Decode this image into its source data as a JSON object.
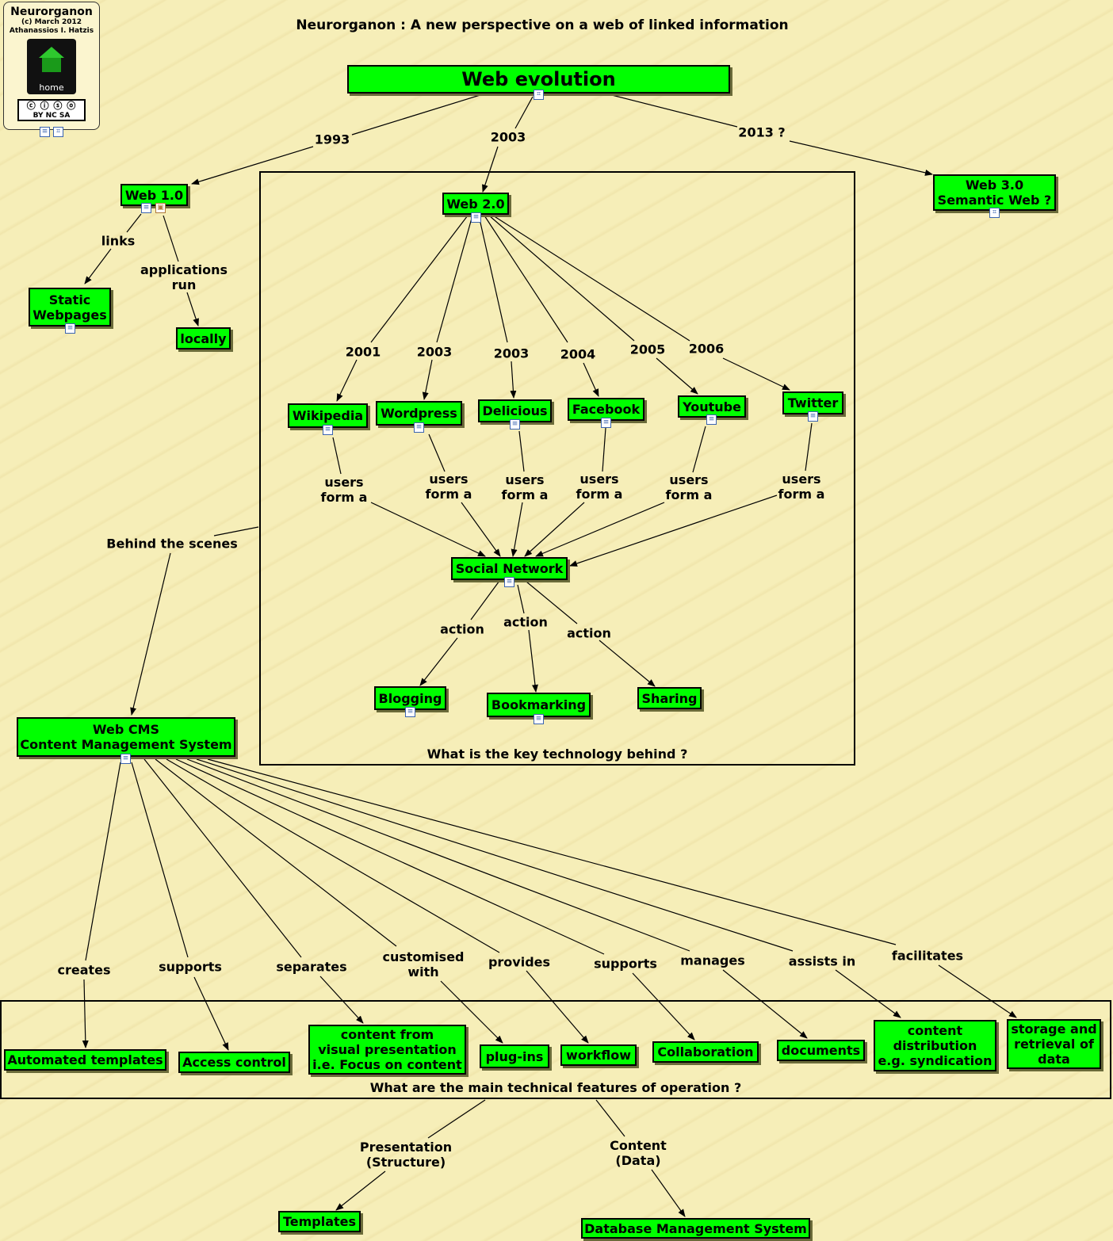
{
  "title": "Neurorganon : A new perspective on a web of linked information",
  "logo": {
    "name": "Neurorganon",
    "copyright": "(c) March 2012",
    "author": "Athanassios I. Hatzis",
    "home_label": "home",
    "license": "BY NC SA"
  },
  "colors": {
    "node_fill": "#00ff00",
    "background": "#f6eeb8",
    "link": "#000000"
  },
  "nodes": {
    "web_evolution": "Web evolution",
    "web10": "Web 1.0",
    "web20": "Web 2.0",
    "web30": "Web 3.0\nSemantic Web ?",
    "static": "Static\nWebpages",
    "locally": "locally",
    "wikipedia": "Wikipedia",
    "wordpress": "Wordpress",
    "delicious": "Delicious",
    "facebook": "Facebook",
    "youtube": "Youtube",
    "twitter": "Twitter",
    "social": "Social Network",
    "blogging": "Blogging",
    "bookmarking": "Bookmarking",
    "sharing": "Sharing",
    "cms": "Web CMS\nContent Management System",
    "auto_templates": "Automated templates",
    "access": "Access control",
    "content_visual": "content from\nvisual presentation\ni.e. Focus on content",
    "plugins": "plug-ins",
    "workflow": "workflow",
    "collab": "Collaboration",
    "documents": "documents",
    "distribution": "content\ndistribution\ne.g. syndication",
    "storage": "storage and\nretrieval of\ndata",
    "templates": "Templates",
    "dbms": "Database Management System"
  },
  "link_labels": {
    "y1993": "1993",
    "y2003": "2003",
    "y2013": "2013 ?",
    "links": "links",
    "apps_run": "applications\nrun",
    "wiki_year": "2001",
    "wp_year": "2003",
    "del_year": "2003",
    "fb_year": "2004",
    "yt_year": "2005",
    "tw_year": "2006",
    "users_form": "users\nform a",
    "action": "action",
    "behind": "Behind the scenes",
    "creates": "creates",
    "supports": "supports",
    "separates": "separates",
    "customised": "customised\nwith",
    "provides": "provides",
    "manages": "manages",
    "assists": "assists in",
    "facilitates": "facilitates",
    "presentation": "Presentation\n(Structure)",
    "content_data": "Content\n(Data)"
  },
  "boxes": {
    "web20_caption": "What is the key technology behind ?",
    "features_caption": "What are the main technical features of operation ?"
  }
}
